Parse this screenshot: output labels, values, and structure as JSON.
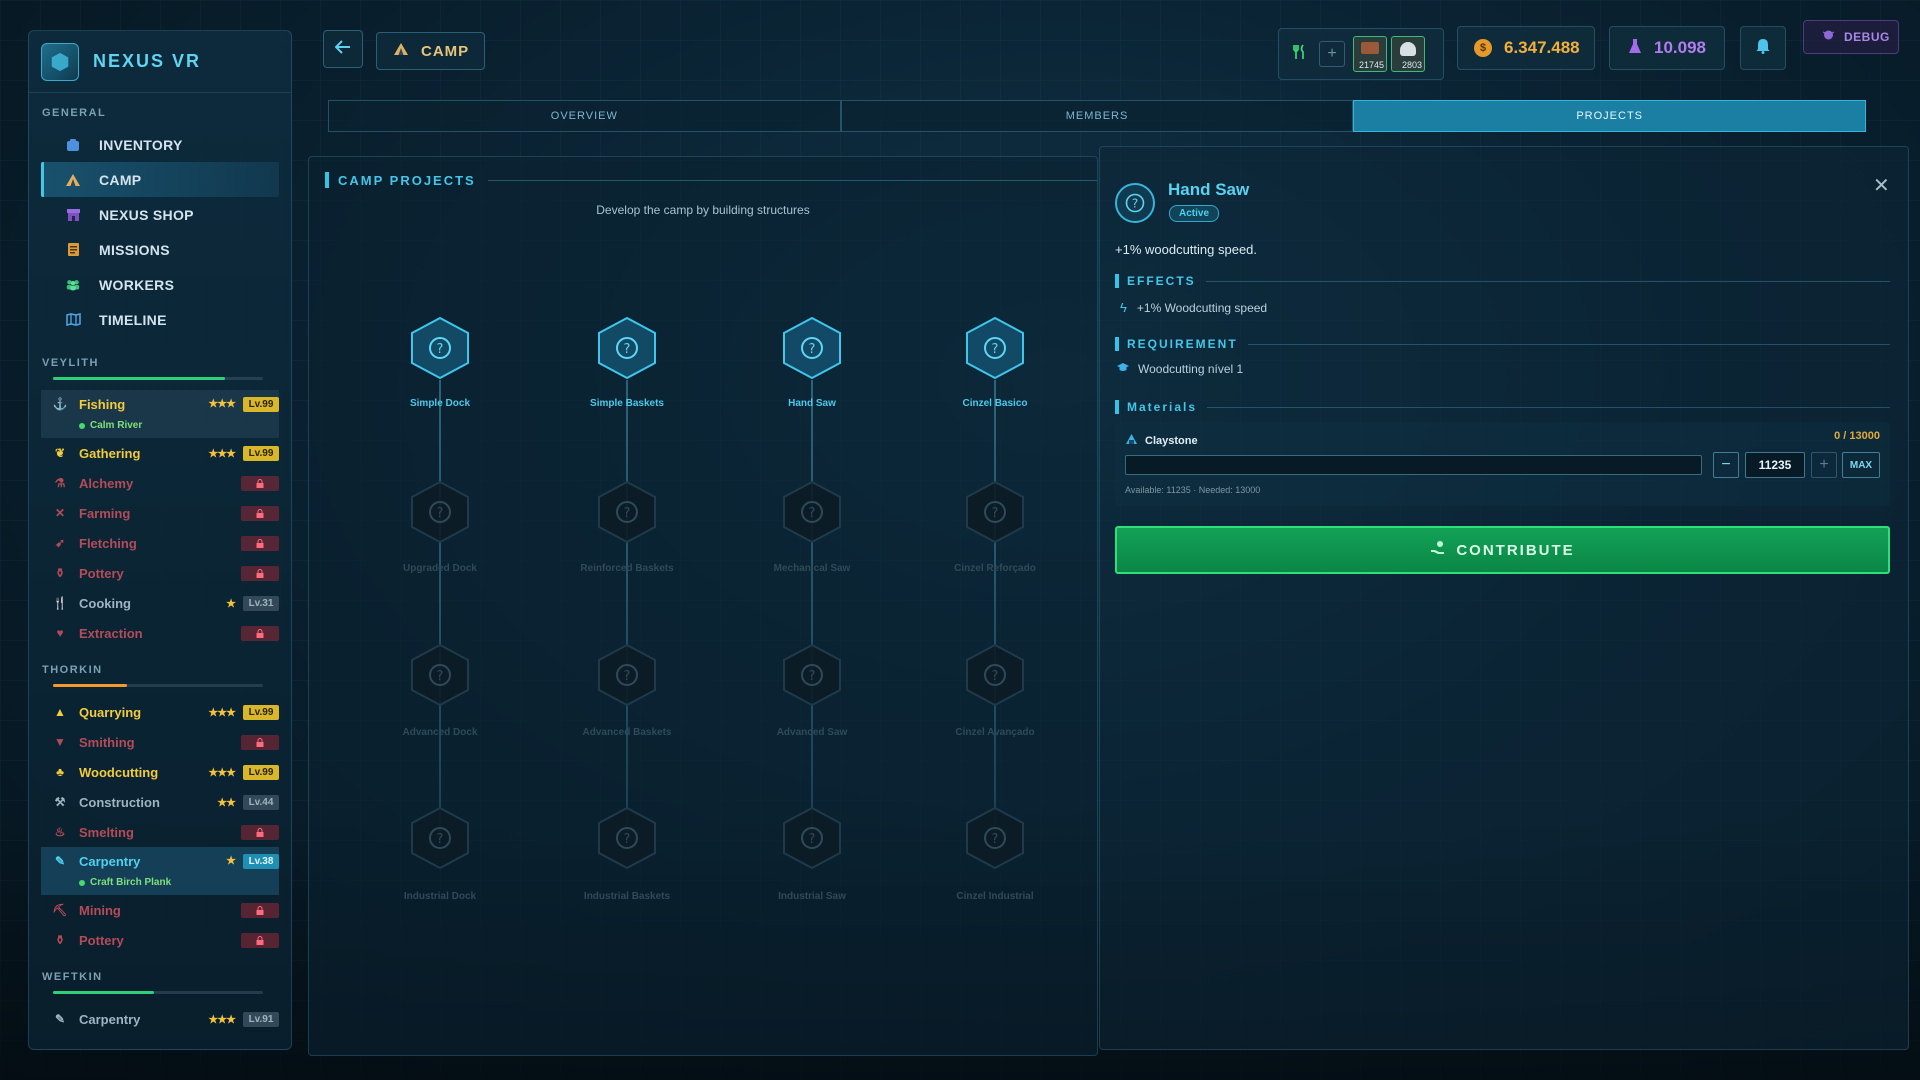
{
  "brand": {
    "title": "NEXUS VR"
  },
  "sidebar": {
    "general_title": "GENERAL",
    "nav": [
      {
        "label": "INVENTORY",
        "icon": "inventory-icon"
      },
      {
        "label": "CAMP",
        "icon": "camp-icon",
        "active": true
      },
      {
        "label": "NEXUS SHOP",
        "icon": "shop-icon"
      },
      {
        "label": "MISSIONS",
        "icon": "missions-icon"
      },
      {
        "label": "WORKERS",
        "icon": "workers-icon"
      },
      {
        "label": "TIMELINE",
        "icon": "timeline-icon"
      }
    ],
    "races": [
      {
        "name": "VEYLITH",
        "progress": 0.82,
        "bar_color": "#2fd07a",
        "skills": [
          {
            "name": "Fishing",
            "stars": "★★★",
            "level": "Lv.99",
            "status": "Calm River"
          },
          {
            "name": "Gathering",
            "stars": "★★★",
            "level": "Lv.99"
          },
          {
            "name": "Alchemy"
          },
          {
            "name": "Farming"
          },
          {
            "name": "Fletching"
          },
          {
            "name": "Pottery"
          },
          {
            "name": "Cooking",
            "stars": "★",
            "level": "Lv.31"
          },
          {
            "name": "Extraction"
          }
        ]
      },
      {
        "name": "THORKIN",
        "progress": 0.35,
        "bar_color": "#f29a2e",
        "skills": [
          {
            "name": "Quarrying",
            "stars": "★★★",
            "level": "Lv.99"
          },
          {
            "name": "Smithing"
          },
          {
            "name": "Woodcutting",
            "stars": "★★★",
            "level": "Lv.99"
          },
          {
            "name": "Construction",
            "stars": "★★",
            "level": "Lv.44"
          },
          {
            "name": "Smelting"
          },
          {
            "name": "Carpentry",
            "stars": "★",
            "level": "Lv.38",
            "status": "Craft Birch Plank"
          },
          {
            "name": "Mining"
          },
          {
            "name": "Pottery"
          }
        ]
      },
      {
        "name": "WEFTKIN",
        "progress": 0.48,
        "bar_color": "#2fd07a",
        "skills": [
          {
            "name": "Carpentry",
            "stars": "★★★",
            "level": "Lv.91"
          }
        ]
      }
    ]
  },
  "header": {
    "back_icon": "arrow-left-icon",
    "breadcrumb": "CAMP",
    "resource_counts": [
      "21745",
      "2803"
    ],
    "coins": "6.347.488",
    "gems": "10.098",
    "debug_label": "DEBUG"
  },
  "tabs": [
    "OVERVIEW",
    "MEMBERS",
    "PROJECTS"
  ],
  "active_tab": "PROJECTS",
  "camp_projects": {
    "title": "CAMP PROJECTS",
    "subtitle": "Develop the camp by building structures",
    "columns": [
      [
        "Simple Dock",
        "Upgraded Dock",
        "Advanced Dock",
        "Industrial Dock"
      ],
      [
        "Simple Baskets",
        "Reinforced Baskets",
        "Advanced Baskets",
        "Industrial Baskets"
      ],
      [
        "Hand Saw",
        "Mechanical Saw",
        "Advanced Saw",
        "Industrial Saw"
      ],
      [
        "Cinzel Basico",
        "Cinzel Reforçado",
        "Cinzel Avançado",
        "Cinzel Industrial"
      ]
    ]
  },
  "detail": {
    "title": "Hand Saw",
    "badge": "Active",
    "description": "+1% woodcutting speed.",
    "effects_title": "EFFECTS",
    "effect": "+1% Woodcutting speed",
    "requirement_title": "REQUIREMENT",
    "requirement": "Woodcutting nível 1",
    "materials_title": "Materials",
    "material": {
      "name": "Claystone",
      "progress_text": "0 / 13000",
      "progress": 0,
      "amount": "11235",
      "max_label": "MAX",
      "availability": "Available: 11235 · Needed: 13000"
    },
    "contribute_label": "CONTRIBUTE"
  }
}
